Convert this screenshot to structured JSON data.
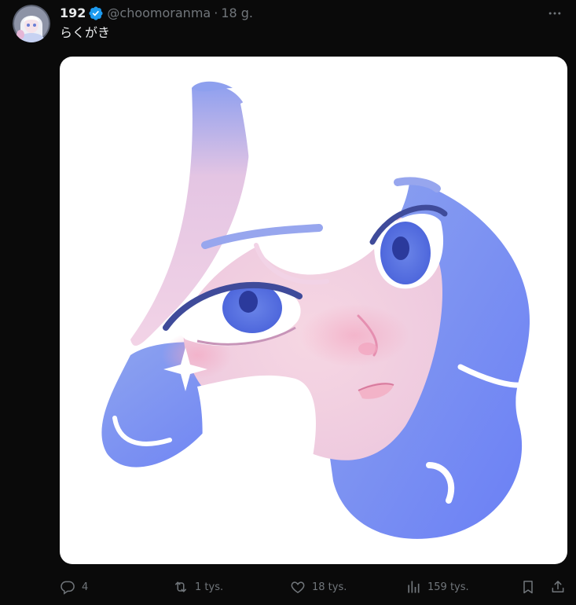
{
  "author": {
    "display_name": "192",
    "handle": "@choomoranma",
    "separator": "·",
    "time": "18 g.",
    "verified": true
  },
  "tweet": {
    "text": "らくがき"
  },
  "actions": {
    "reply": {
      "icon": "reply-icon",
      "count": "4"
    },
    "repost": {
      "icon": "repost-icon",
      "count": "1 tys."
    },
    "like": {
      "icon": "heart-icon",
      "count": "18 tys."
    },
    "views": {
      "icon": "analytics-icon",
      "count": "159 tys."
    },
    "bookmark": {
      "icon": "bookmark-icon"
    },
    "share": {
      "icon": "share-icon"
    }
  },
  "colors": {
    "background": "#0a0a0a",
    "text_primary": "#e7e9ea",
    "text_secondary": "#71767b",
    "verified_blue": "#1d9bf0"
  }
}
